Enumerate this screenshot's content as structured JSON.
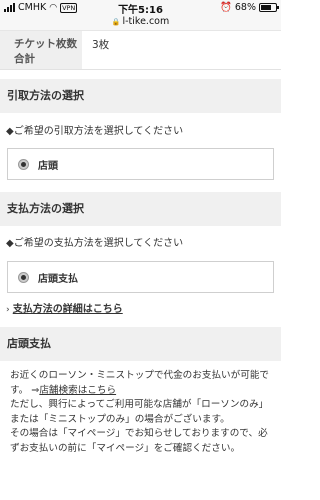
{
  "status_bar": {
    "carrier": "CMHK",
    "vpn": "VPN",
    "time": "下午5:16",
    "battery_percent": "68%",
    "battery_level": 0.68
  },
  "url_bar": {
    "url": "l-tike.com"
  },
  "ticket": {
    "label": "チケット枚数合計",
    "value": "3枚"
  },
  "pickup": {
    "header": "引取方法の選択",
    "instruction": "◆ご希望の引取方法を選択してください",
    "option": "店頭"
  },
  "payment": {
    "header": "支払方法の選択",
    "instruction": "◆ご希望の支払方法を選択してください",
    "option": "店頭支払",
    "detail_link": "支払方法の詳細はこちら"
  },
  "store_payment": {
    "header": "店頭支払",
    "line1": "お近くのローソン・ミニストップで代金のお支払いが可能です。",
    "arrow": "⇒",
    "store_search_link": "店舗検索はこちら",
    "line2": "ただし、興行によってご利用可能な店舗が「ローソンのみ」または「ミニストップのみ」の場合がございます。",
    "line3": "その場合は「マイページ」でお知らせしておりますので、必ずお支払いの前に「マイページ」をご確認ください。"
  }
}
